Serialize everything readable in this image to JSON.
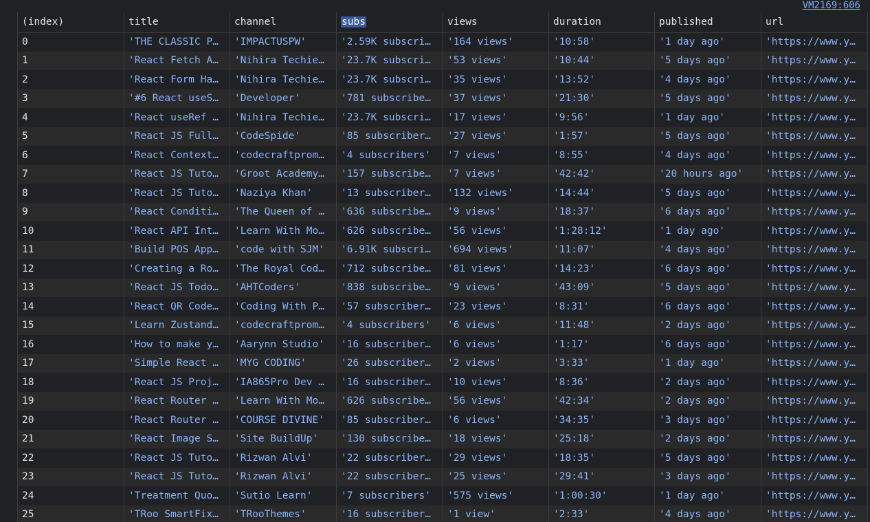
{
  "source_link": "VM2169:606",
  "columns": [
    "(index)",
    "title",
    "channel",
    "subs",
    "views",
    "duration",
    "published",
    "url"
  ],
  "rows": [
    [
      "0",
      "'THE CLASSIC P…",
      "'IMPACTUSPW'",
      "'2.59K subscri…",
      "'164 views'",
      "'10:58'",
      "'1 day ago'",
      "'https://www.y…"
    ],
    [
      "1",
      "'React Fetch A…",
      "'Nihira Techie…",
      "'23.7K subscri…",
      "'53 views'",
      "'10:44'",
      "'5 days ago'",
      "'https://www.y…"
    ],
    [
      "2",
      "'React Form Ha…",
      "'Nihira Techie…",
      "'23.7K subscri…",
      "'35 views'",
      "'13:52'",
      "'4 days ago'",
      "'https://www.y…"
    ],
    [
      "3",
      "'#6 React useS…",
      "'Developer'",
      "'781 subscribe…",
      "'37 views'",
      "'21:30'",
      "'5 days ago'",
      "'https://www.y…"
    ],
    [
      "4",
      "'React useRef …",
      "'Nihira Techie…",
      "'23.7K subscri…",
      "'17 views'",
      "'9:56'",
      "'1 day ago'",
      "'https://www.y…"
    ],
    [
      "5",
      "'React JS Full…",
      "'CodeSpide'",
      "'85 subscriber…",
      "'27 views'",
      "'1:57'",
      "'5 days ago'",
      "'https://www.y…"
    ],
    [
      "6",
      "'React Context…",
      "'codecraftprom…",
      "'4 subscribers'",
      "'7 views'",
      "'8:55'",
      "'4 days ago'",
      "'https://www.y…"
    ],
    [
      "7",
      "'React JS Tuto…",
      "'Groot Academy…",
      "'157 subscribe…",
      "'7 views'",
      "'42:42'",
      "'20 hours ago'",
      "'https://www.y…"
    ],
    [
      "8",
      "'React JS Tuto…",
      "'Naziya Khan'",
      "'13 subscriber…",
      "'132 views'",
      "'14:44'",
      "'5 days ago'",
      "'https://www.y…"
    ],
    [
      "9",
      "'React Conditi…",
      "'The Queen of …",
      "'636 subscribe…",
      "'9 views'",
      "'18:37'",
      "'6 days ago'",
      "'https://www.y…"
    ],
    [
      "10",
      "'React API Int…",
      "'Learn With Mo…",
      "'626 subscribe…",
      "'56 views'",
      "'1:28:12'",
      "'1 day ago'",
      "'https://www.y…"
    ],
    [
      "11",
      "'Build POS App…",
      "'code with SJM'",
      "'6.91K subscri…",
      "'694 views'",
      "'11:07'",
      "'4 days ago'",
      "'https://www.y…"
    ],
    [
      "12",
      "'Creating a Ro…",
      "'The Royal Cod…",
      "'712 subscribe…",
      "'81 views'",
      "'14:23'",
      "'6 days ago'",
      "'https://www.y…"
    ],
    [
      "13",
      "'React JS Todo…",
      "'AHTCoders'",
      "'838 subscribe…",
      "'9 views'",
      "'43:09'",
      "'5 days ago'",
      "'https://www.y…"
    ],
    [
      "14",
      "'React QR Code…",
      "'Coding With P…",
      "'57 subscriber…",
      "'23 views'",
      "'8:31'",
      "'6 days ago'",
      "'https://www.y…"
    ],
    [
      "15",
      "'Learn Zustand…",
      "'codecraftprom…",
      "'4 subscribers'",
      "'6 views'",
      "'11:48'",
      "'2 days ago'",
      "'https://www.y…"
    ],
    [
      "16",
      "'How to make y…",
      "'Aarynn Studio'",
      "'16 subscriber…",
      "'6 views'",
      "'1:17'",
      "'6 days ago'",
      "'https://www.y…"
    ],
    [
      "17",
      "'Simple React …",
      "'MYG CODING'",
      "'26 subscriber…",
      "'2 views'",
      "'3:33'",
      "'1 day ago'",
      "'https://www.y…"
    ],
    [
      "18",
      "'React JS Proj…",
      "'IA865Pro Dev …",
      "'16 subscriber…",
      "'10 views'",
      "'8:36'",
      "'2 days ago'",
      "'https://www.y…"
    ],
    [
      "19",
      "'React Router …",
      "'Learn With Mo…",
      "'626 subscribe…",
      "'56 views'",
      "'42:34'",
      "'2 days ago'",
      "'https://www.y…"
    ],
    [
      "20",
      "'React Router …",
      "'COURSE DIVINE'",
      "'85 subscriber…",
      "'6 views'",
      "'34:35'",
      "'3 days ago'",
      "'https://www.y…"
    ],
    [
      "21",
      "'React Image S…",
      "'Site BuildUp'",
      "'130 subscribe…",
      "'18 views'",
      "'25:18'",
      "'2 days ago'",
      "'https://www.y…"
    ],
    [
      "22",
      "'React JS Tuto…",
      "'Rizwan Alvi'",
      "'22 subscriber…",
      "'29 views'",
      "'18:35'",
      "'5 days ago'",
      "'https://www.y…"
    ],
    [
      "23",
      "'React JS Tuto…",
      "'Rizwan Alvi'",
      "'22 subscriber…",
      "'25 views'",
      "'29:41'",
      "'3 days ago'",
      "'https://www.y…"
    ],
    [
      "24",
      "'Treatment Quo…",
      "'Sutio Learn'",
      "'7 subscribers'",
      "'575 views'",
      "'1:00:30'",
      "'1 day ago'",
      "'https://www.y…"
    ],
    [
      "25",
      "'TRoo SmartFix…",
      "'TRooThemes'",
      "'16 subscriber…",
      "'1 view'",
      "'2:33'",
      "'4 days ago'",
      "'https://www.y…"
    ]
  ],
  "colors": {
    "background": "#202124",
    "row_alt": "#2a2a2a",
    "string_value": "#8ab4f8",
    "header_text": "#e3e3e3",
    "link": "#7cacf8",
    "selection": "#3c5a99"
  }
}
